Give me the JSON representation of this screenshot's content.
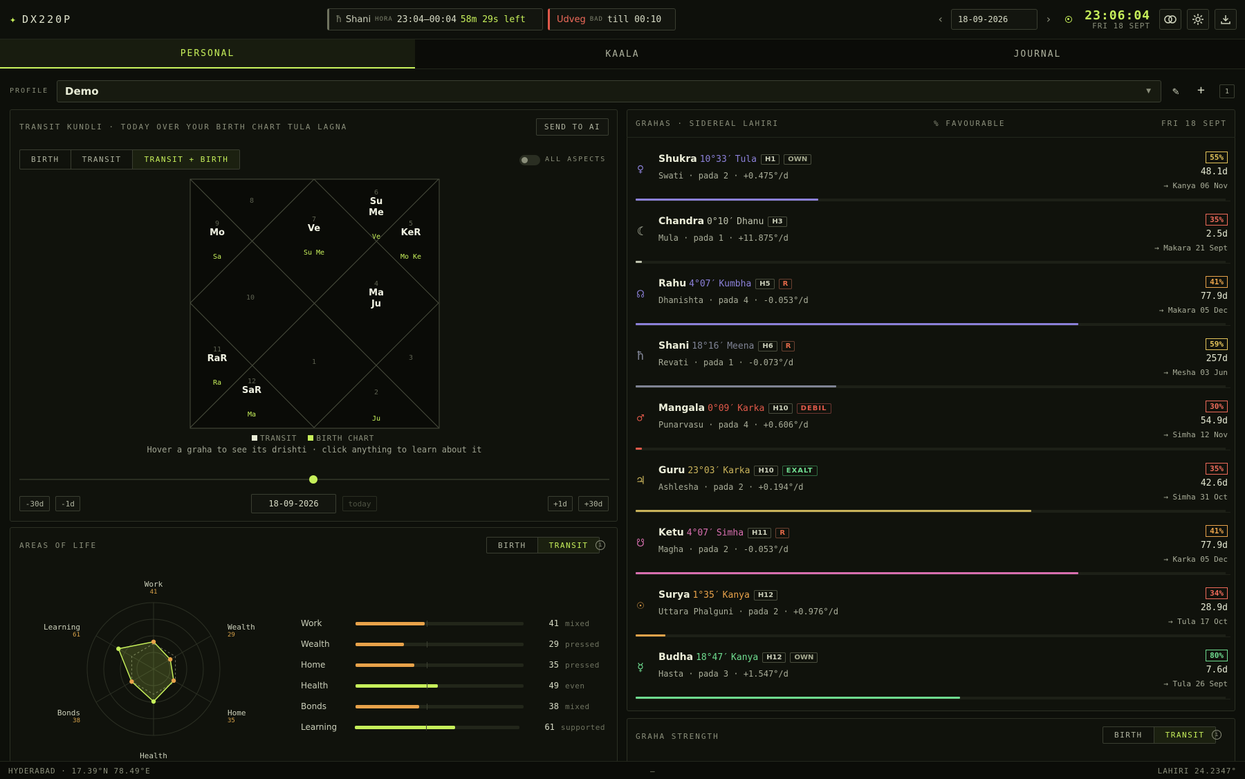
{
  "app": {
    "logo": "DX220P"
  },
  "hora": {
    "planet_icon": "ħ",
    "planet": "Shani",
    "label": "HORA",
    "range": "23:04–00:04",
    "left": "58m 29s left"
  },
  "choghadiya": {
    "name": "Udveg",
    "label": "BAD",
    "till": "till 00:10"
  },
  "date": {
    "value": "18-09-2026",
    "prev": "‹",
    "next": "›"
  },
  "clock": {
    "time": "23:06:04",
    "day": "FRI 18 SEPT"
  },
  "tabs": [
    {
      "label": "PERSONAL"
    },
    {
      "label": "KAALA"
    },
    {
      "label": "JOURNAL"
    }
  ],
  "profile": {
    "label": "PROFILE",
    "name": "Demo",
    "count": "1"
  },
  "kundli": {
    "title": "TRANSIT KUNDLI · TODAY OVER YOUR BIRTH CHART TULA LAGNA",
    "send_ai": "SEND TO AI",
    "modes": [
      "BIRTH",
      "TRANSIT",
      "TRANSIT + BIRTH"
    ],
    "all_aspects": "ALL ASPECTS",
    "legend_transit": "TRANSIT",
    "legend_birth": "BIRTH CHART",
    "hint": "Hover a graha to see its drishti · click anything to learn about it",
    "minus30": "-30d",
    "minus1": "-1d",
    "plus1": "+1d",
    "plus30": "+30d",
    "date": "18-09-2026",
    "today": "today",
    "houses": [
      {
        "n": "8",
        "t": "",
        "b": ""
      },
      {
        "n": "9",
        "t": "Mo",
        "b": "Sa"
      },
      {
        "n": "7",
        "t": "Ve",
        "b": "Su Me"
      },
      {
        "n": "6",
        "t": "Su\nMe",
        "b": "Ve"
      },
      {
        "n": "5",
        "t": "KeR",
        "b": "Mo Ke"
      },
      {
        "n": "10",
        "t": "",
        "b": ""
      },
      {
        "n": "4",
        "t": "Ma\nJu",
        "b": ""
      },
      {
        "n": "11",
        "t": "RaR",
        "b": "Ra"
      },
      {
        "n": "1",
        "t": "",
        "b": ""
      },
      {
        "n": "3",
        "t": "",
        "b": ""
      },
      {
        "n": "12",
        "t": "SaR",
        "b": "Ma"
      },
      {
        "n": "2",
        "t": "",
        "b": "Ju"
      }
    ]
  },
  "areas": {
    "title": "AREAS OF LIFE",
    "modes": [
      "BIRTH",
      "TRANSIT"
    ],
    "items": [
      {
        "name": "Work",
        "value": 41,
        "state": "mixed",
        "color": "#e8a24a"
      },
      {
        "name": "Wealth",
        "value": 29,
        "state": "pressed",
        "color": "#e8a24a"
      },
      {
        "name": "Home",
        "value": 35,
        "state": "pressed",
        "color": "#e8a24a"
      },
      {
        "name": "Health",
        "value": 49,
        "state": "even",
        "color": "#c6ef5a"
      },
      {
        "name": "Bonds",
        "value": 38,
        "state": "mixed",
        "color": "#e8a24a"
      },
      {
        "name": "Learning",
        "value": 61,
        "state": "supported",
        "color": "#c6ef5a"
      }
    ]
  },
  "grahas": {
    "title": "GRAHAS · SIDEREAL LAHIRI",
    "fav": "% FAVOURABLE",
    "date": "FRI 18 SEPT",
    "items": [
      {
        "icon": "♀",
        "name": "Shukra",
        "deg": "10°33′",
        "rashi": "Tula",
        "house": "H1",
        "tag": "OWN",
        "tagcls": "own",
        "sub": "Swati · pada 2 · +0.475°/d",
        "pct": "55%",
        "dur": "48.1d",
        "next": "→ Kanya 06 Nov",
        "frac": 0.31,
        "color": "#8b80d8",
        "pctcolor": "#e3c35a"
      },
      {
        "icon": "☾",
        "name": "Chandra",
        "deg": "0°10′",
        "rashi": "Dhanu",
        "house": "H3",
        "tag": "",
        "tagcls": "",
        "sub": "Mula · pada 1 · +11.875°/d",
        "pct": "35%",
        "dur": "2.5d",
        "next": "→ Makara 21 Sept",
        "frac": 0.01,
        "color": "#bfc3ae",
        "pctcolor": "#ef6a5a"
      },
      {
        "icon": "☊",
        "name": "Rahu",
        "deg": "4°07′",
        "rashi": "Kumbha",
        "house": "H5",
        "tag": "R",
        "tagcls": "r",
        "sub": "Dhanishta · pada 4 · -0.053°/d",
        "pct": "41%",
        "dur": "77.9d",
        "next": "→ Makara 05 Dec",
        "frac": 0.75,
        "color": "#8b80d8",
        "pctcolor": "#e8a24a"
      },
      {
        "icon": "ħ",
        "name": "Shani",
        "deg": "18°16′",
        "rashi": "Meena",
        "house": "H6",
        "tag": "R",
        "tagcls": "r",
        "sub": "Revati · pada 1 · -0.073°/d",
        "pct": "59%",
        "dur": "257d",
        "next": "→ Mesha 03 Jun",
        "frac": 0.34,
        "color": "#7f8394",
        "pctcolor": "#e3c35a"
      },
      {
        "icon": "♂",
        "name": "Mangala",
        "deg": "0°09′",
        "rashi": "Karka",
        "house": "H10",
        "tag": "DEBIL",
        "tagcls": "debil",
        "sub": "Punarvasu · pada 4 · +0.606°/d",
        "pct": "30%",
        "dur": "54.9d",
        "next": "→ Simha 12 Nov",
        "frac": 0.01,
        "color": "#e0594a",
        "pctcolor": "#ef6a5a"
      },
      {
        "icon": "♃",
        "name": "Guru",
        "deg": "23°03′",
        "rashi": "Karka",
        "house": "H10",
        "tag": "EXALT",
        "tagcls": "exalt",
        "sub": "Ashlesha · pada 2 · +0.194°/d",
        "pct": "35%",
        "dur": "42.6d",
        "next": "→ Simha 31 Oct",
        "frac": 0.67,
        "color": "#c8b25a",
        "pctcolor": "#ef6a5a"
      },
      {
        "icon": "☋",
        "name": "Ketu",
        "deg": "4°07′",
        "rashi": "Simha",
        "house": "H11",
        "tag": "R",
        "tagcls": "r",
        "sub": "Magha · pada 2 · -0.053°/d",
        "pct": "41%",
        "dur": "77.9d",
        "next": "→ Karka 05 Dec",
        "frac": 0.75,
        "color": "#d86fb0",
        "pctcolor": "#e8a24a"
      },
      {
        "icon": "☉",
        "name": "Surya",
        "deg": "1°35′",
        "rashi": "Kanya",
        "house": "H12",
        "tag": "",
        "tagcls": "",
        "sub": "Uttara Phalguni · pada 2 · +0.976°/d",
        "pct": "34%",
        "dur": "28.9d",
        "next": "→ Tula 17 Oct",
        "frac": 0.05,
        "color": "#e8a24a",
        "pctcolor": "#ef6a5a"
      },
      {
        "icon": "☿",
        "name": "Budha",
        "deg": "18°47′",
        "rashi": "Kanya",
        "house": "H12",
        "tag": "OWN",
        "tagcls": "own",
        "sub": "Hasta · pada 3 · +1.547°/d",
        "pct": "80%",
        "dur": "7.6d",
        "next": "→ Tula 26 Sept",
        "frac": 0.55,
        "color": "#6edb8f",
        "pctcolor": "#6edb8f"
      }
    ]
  },
  "strength": {
    "title": "GRAHA STRENGTH",
    "modes": [
      "BIRTH",
      "TRANSIT"
    ]
  },
  "status": {
    "location": "HYDERABAD · 17.39°N 78.49°E",
    "mid": "—",
    "ayanamsa": "LAHIRI 24.2347°"
  }
}
